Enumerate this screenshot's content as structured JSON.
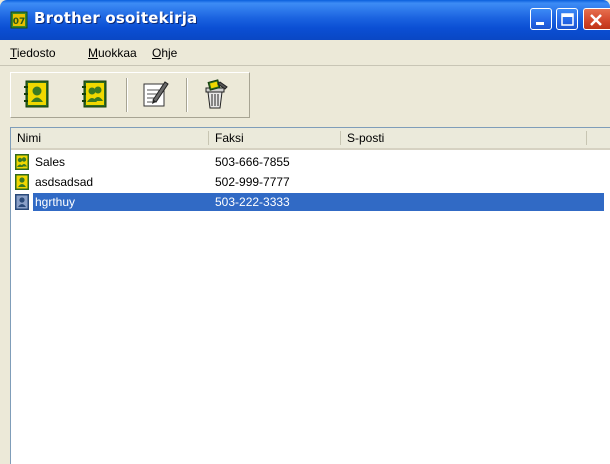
{
  "window": {
    "title": "Brother osoitekirja"
  },
  "title_buttons": {
    "minimize_icon": "minimize-icon",
    "maximize_icon": "maximize-icon",
    "close_icon": "close-icon"
  },
  "menu": {
    "items": [
      {
        "underlined": "T",
        "rest": "iedosto"
      },
      {
        "underlined": "M",
        "rest": "uokkaa"
      },
      {
        "underlined": "O",
        "rest": "hje"
      }
    ]
  },
  "toolbar": {
    "buttons": [
      {
        "icon": "new-contact-icon"
      },
      {
        "icon": "new-group-icon"
      },
      {
        "icon": "edit-icon"
      },
      {
        "icon": "delete-icon"
      }
    ]
  },
  "list": {
    "columns": [
      "Nimi",
      "Faksi",
      "S-posti"
    ],
    "rows": [
      {
        "name": "Sales",
        "fax": "503-666-7855",
        "email": "",
        "type": "group",
        "selected": false
      },
      {
        "name": "asdsadsad",
        "fax": "502-999-7777",
        "email": "",
        "type": "contact",
        "selected": false
      },
      {
        "name": "hgrthuy",
        "fax": "503-222-3333",
        "email": "",
        "type": "contact",
        "selected": true
      }
    ]
  },
  "colors": {
    "titlebar": "#0b4fd4",
    "selection": "#316ac5",
    "close_button": "#d2462a",
    "window_face": "#ece9d8"
  }
}
